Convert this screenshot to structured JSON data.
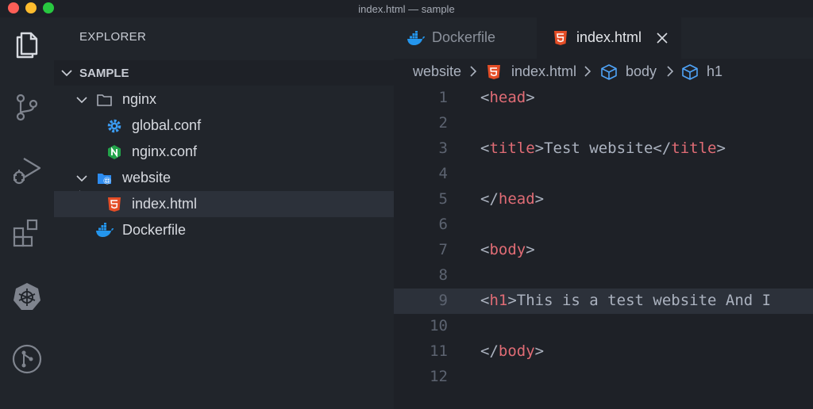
{
  "window": {
    "title": "index.html — sample"
  },
  "activity_bar": [
    "files-icon",
    "source-control-icon",
    "run-debug-icon",
    "extensions-icon",
    "kubernetes-icon",
    "git-graph-icon"
  ],
  "explorer": {
    "header": "EXPLORER",
    "section": "SAMPLE",
    "tree": [
      {
        "label": "nginx",
        "type": "folder"
      },
      {
        "label": "global.conf",
        "type": "file"
      },
      {
        "label": "nginx.conf",
        "type": "file"
      },
      {
        "label": "website",
        "type": "folder"
      },
      {
        "label": "index.html",
        "type": "file",
        "selected": true
      },
      {
        "label": "Dockerfile",
        "type": "file"
      }
    ]
  },
  "tabs": [
    {
      "label": "Dockerfile",
      "active": false
    },
    {
      "label": "index.html",
      "active": true
    }
  ],
  "breadcrumb": [
    "website",
    "index.html",
    "body",
    "h1"
  ],
  "editor": {
    "lines": [
      {
        "num": "1",
        "open": "<",
        "tag": "head",
        "close": ">",
        "text": "",
        "open2": "",
        "tag2": "",
        "close2": ""
      },
      {
        "num": "2",
        "open": "",
        "tag": "",
        "close": "",
        "text": "",
        "open2": "",
        "tag2": "",
        "close2": ""
      },
      {
        "num": "3",
        "open": "<",
        "tag": "title",
        "close": ">",
        "text": "Test website",
        "open2": "</",
        "tag2": "title",
        "close2": ">"
      },
      {
        "num": "4",
        "open": "",
        "tag": "",
        "close": "",
        "text": "",
        "open2": "",
        "tag2": "",
        "close2": ""
      },
      {
        "num": "5",
        "open": "</",
        "tag": "head",
        "close": ">",
        "text": "",
        "open2": "",
        "tag2": "",
        "close2": ""
      },
      {
        "num": "6",
        "open": "",
        "tag": "",
        "close": "",
        "text": "",
        "open2": "",
        "tag2": "",
        "close2": ""
      },
      {
        "num": "7",
        "open": "<",
        "tag": "body",
        "close": ">",
        "text": "",
        "open2": "",
        "tag2": "",
        "close2": ""
      },
      {
        "num": "8",
        "open": "",
        "tag": "",
        "close": "",
        "text": "",
        "open2": "",
        "tag2": "",
        "close2": ""
      },
      {
        "num": "9",
        "open": "<",
        "tag": "h1",
        "close": ">",
        "text": "This is a test website And I",
        "open2": "",
        "tag2": "",
        "close2": ""
      },
      {
        "num": "10",
        "open": "",
        "tag": "",
        "close": "",
        "text": "",
        "open2": "",
        "tag2": "",
        "close2": ""
      },
      {
        "num": "11",
        "open": "</",
        "tag": "body",
        "close": ">",
        "text": "",
        "open2": "",
        "tag2": "",
        "close2": ""
      },
      {
        "num": "12",
        "open": "",
        "tag": "",
        "close": "",
        "text": "",
        "open2": "",
        "tag2": "",
        "close2": ""
      }
    ],
    "current_line": "9"
  },
  "colors": {
    "tag": "#e06c75",
    "text": "#abb2bf",
    "html_icon": "#e44d26",
    "docker_icon": "#2496ed",
    "nginx_icon": "#22a34a",
    "gear_icon": "#3b9cf3",
    "folder_blue": "#2d8cf0"
  }
}
